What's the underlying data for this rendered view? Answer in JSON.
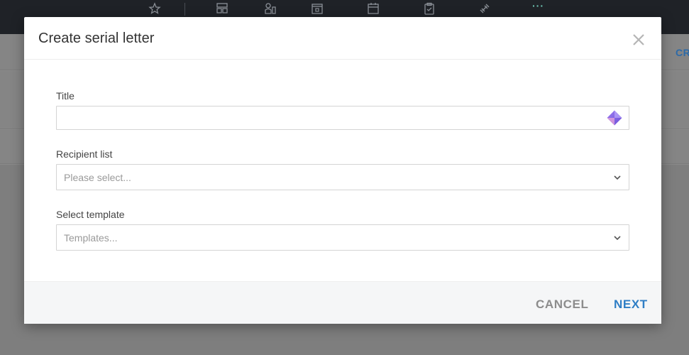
{
  "background": {
    "toolbar_more": "···",
    "partial_button": "CR"
  },
  "modal": {
    "title": "Create serial letter",
    "fields": {
      "title": {
        "label": "Title",
        "value": "",
        "placeholder": ""
      },
      "recipient_list": {
        "label": "Recipient list",
        "placeholder": "Please select..."
      },
      "template": {
        "label": "Select template",
        "placeholder": "Templates..."
      }
    },
    "footer": {
      "cancel_label": "CANCEL",
      "next_label": "NEXT"
    }
  },
  "colors": {
    "accent": "#2f7ec5",
    "cancel": "#8c8c8c",
    "topbar": "#1f2227",
    "toolbar_more": "#6fc7b5"
  },
  "icons": [
    "star-icon",
    "layout-icon",
    "person-card-icon",
    "archive-icon",
    "calendar-icon",
    "clipboard-check-icon",
    "dumbbell-icon",
    "more-dots-icon",
    "close-icon",
    "ai-diamond-icon",
    "chevron-down-icon"
  ]
}
